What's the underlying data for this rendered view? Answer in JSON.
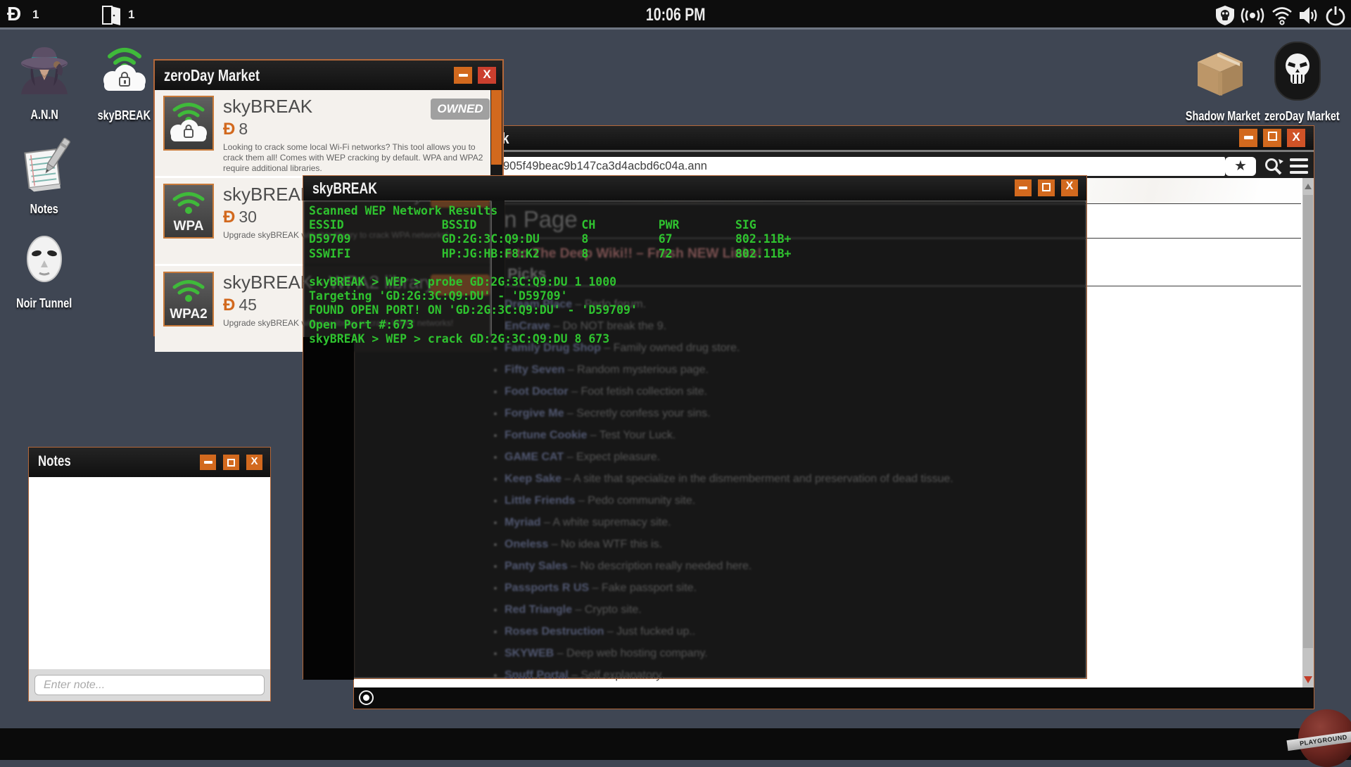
{
  "topbar": {
    "clock": "10:06 PM",
    "doscoin_symbol": "Ð",
    "doscoin_count": "1",
    "door_count": "1"
  },
  "desktop": {
    "icons_left": [
      {
        "label": "A.N.N"
      },
      {
        "label": "skyBREAK"
      },
      {
        "label": "Notes"
      },
      {
        "label": "Noir Tunnel"
      }
    ],
    "icons_right": [
      {
        "label": "Shadow Market"
      },
      {
        "label": "zeroDay Market"
      }
    ]
  },
  "zeroday": {
    "title": "zeroDay Market",
    "products": [
      {
        "name": "skyBREAK",
        "price": "8",
        "badge": "OWNED",
        "description": "Looking to crack some local Wi-Fi networks? This tool allows you to crack them all! Comes with WEP cracking by default. WPA and WPA2 require additional libraries."
      },
      {
        "name": "skyBREAK - WPA library",
        "price": "30",
        "icon_label": "WPA",
        "description": "Upgrade skyBREAK with this library to crack WPA networks!"
      },
      {
        "name": "skyBREAK - WPA2 library",
        "price": "45",
        "icon_label": "WPA2",
        "description": "Upgrade skyBREAK with this library to crack WPA2 networks!"
      }
    ]
  },
  "browser": {
    "title": "The Deep Web Network",
    "url": "905f49beac9b147ca3d4acbd6c04a.ann",
    "star": "★",
    "page": {
      "heading": "Main Page",
      "notice": "Welcome to The Deep Wiki!! – Fresh NEW Links!",
      "section": "Week Picks",
      "separator": " – ",
      "links": [
        {
          "name": "Dream Place",
          "desc": "Pedo forum."
        },
        {
          "name": "EnCrave",
          "desc": "Do NOT break the 9."
        },
        {
          "name": "Family Drug Shop",
          "desc": "Family owned drug store."
        },
        {
          "name": "Fifty Seven",
          "desc": "Random mysterious page."
        },
        {
          "name": "Foot Doctor",
          "desc": "Foot fetish collection site."
        },
        {
          "name": "Forgive Me",
          "desc": "Secretly confess your sins."
        },
        {
          "name": "Fortune Cookie",
          "desc": "Test Your Luck."
        },
        {
          "name": "GAME CAT",
          "desc": "Expect pleasure."
        },
        {
          "name": "Keep Sake",
          "desc": "A site that specialize in the dismemberment and preservation of dead tissue."
        },
        {
          "name": "Little Friends",
          "desc": "Pedo community site."
        },
        {
          "name": "Myriad",
          "desc": "A white supremacy site."
        },
        {
          "name": "Oneless",
          "desc": "No idea WTF this is."
        },
        {
          "name": "Panty Sales",
          "desc": "No description really needed here."
        },
        {
          "name": "Passports R US",
          "desc": "Fake passport site."
        },
        {
          "name": "Red Triangle",
          "desc": "Crypto site."
        },
        {
          "name": "Roses Destruction",
          "desc": "Just fucked up.."
        },
        {
          "name": "SKYWEB",
          "desc": "Deep web hosting company."
        },
        {
          "name": "Snuff Portal",
          "desc": "Self explanatory."
        }
      ]
    }
  },
  "terminal": {
    "title": "skyBREAK",
    "lines": [
      "Scanned WEP Network Results",
      "ESSID              BSSID               CH         PWR        SIG",
      "D59709             GD:2G:3C:Q9:DU      8          67         802.11B+",
      "SSWIFI             HP:JG:HB:F8:K2      8          72         802.11B+",
      "",
      "skyBREAK > WEP > probe GD:2G:3C:Q9:DU 1 1000",
      "Targeting 'GD:2G:3C:Q9:DU' - 'D59709'",
      "FOUND OPEN PORT! ON 'GD:2G:3C:Q9:DU' - 'D59709'",
      "Open Port #:673",
      "skyBREAK > WEP > crack GD:2G:3C:Q9:DU 8 673"
    ]
  },
  "notes": {
    "title": "Notes",
    "placeholder": "Enter note..."
  },
  "logo": {
    "text": "PLAYGROUND"
  }
}
